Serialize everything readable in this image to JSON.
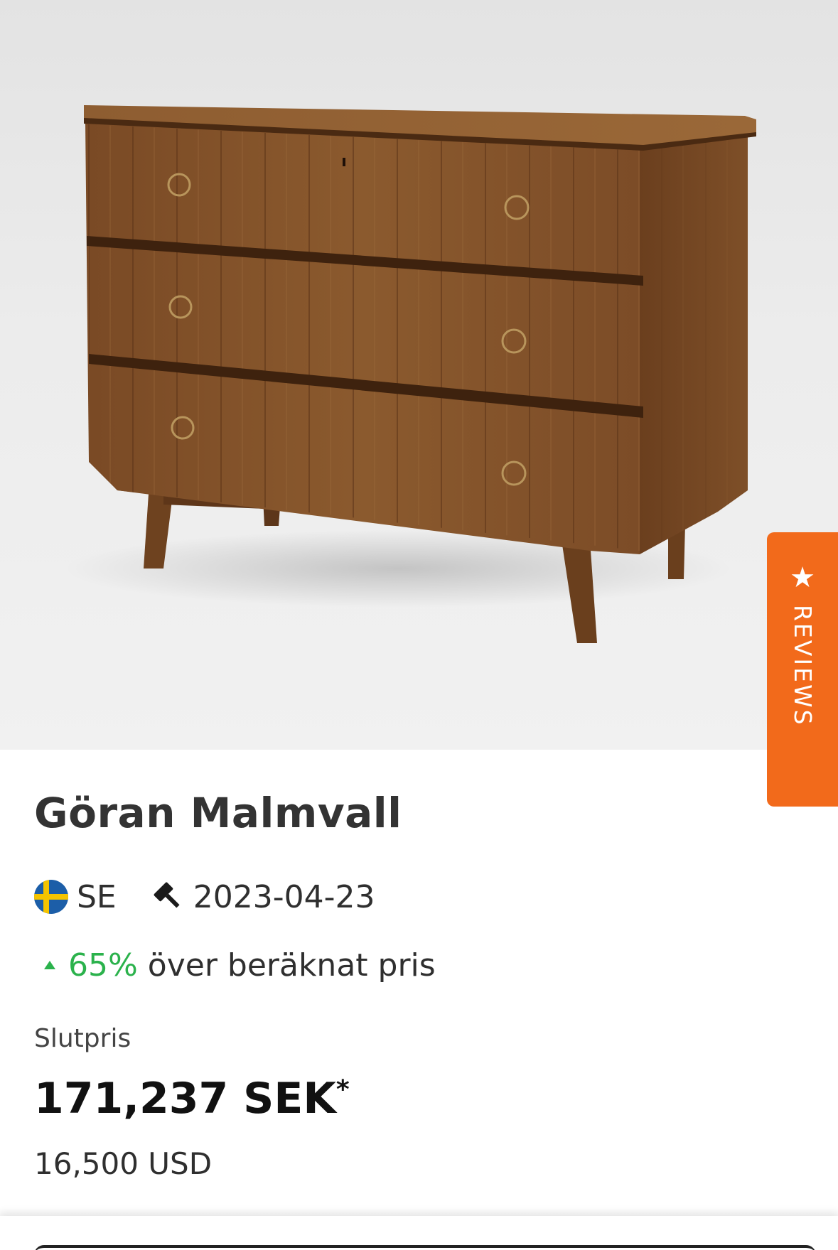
{
  "product": {
    "image_alt": "Wooden chest of drawers",
    "title": "Göran Malmvall",
    "country_code": "SE",
    "country_flag_icon": "sweden-flag-icon",
    "auction_icon": "gavel-icon",
    "auction_date": "2023-04-23",
    "estimate_change_icon": "triangle-up-icon",
    "estimate_percent": "65%",
    "estimate_text": "över beräknat pris",
    "final_price_label": "Slutpris",
    "final_price": "171,237 SEK",
    "final_price_footnote": "*",
    "final_price_usd": "16,500 USD"
  },
  "reviews_tab": {
    "icon": "star-icon",
    "label": "REVIEWS"
  },
  "colors": {
    "accent_orange": "#f26a1b",
    "positive_green": "#2bb24c",
    "flag_blue": "#1c5ea8",
    "flag_yellow": "#f5c400"
  }
}
